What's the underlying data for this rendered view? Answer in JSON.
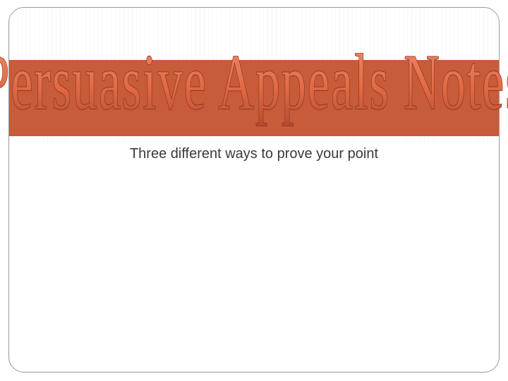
{
  "slide": {
    "title": "Persuasive Appeals Notes",
    "subtitle": "Three different ways to prove your point"
  },
  "colors": {
    "band": "#c75b3a",
    "title_fill_top": "#f08a6a",
    "title_fill_bottom": "#b84a2e",
    "title_stroke": "#7a2e1c",
    "subtitle": "#3a3a3a"
  }
}
